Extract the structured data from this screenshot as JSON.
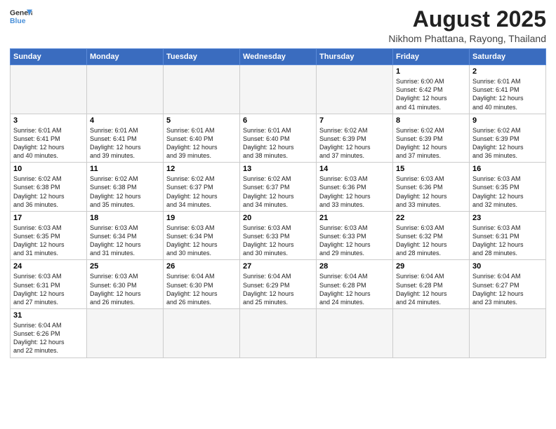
{
  "header": {
    "logo_general": "General",
    "logo_blue": "Blue",
    "title": "August 2025",
    "subtitle": "Nikhom Phattana, Rayong, Thailand"
  },
  "weekdays": [
    "Sunday",
    "Monday",
    "Tuesday",
    "Wednesday",
    "Thursday",
    "Friday",
    "Saturday"
  ],
  "weeks": [
    [
      {
        "day": "",
        "info": ""
      },
      {
        "day": "",
        "info": ""
      },
      {
        "day": "",
        "info": ""
      },
      {
        "day": "",
        "info": ""
      },
      {
        "day": "",
        "info": ""
      },
      {
        "day": "1",
        "info": "Sunrise: 6:00 AM\nSunset: 6:42 PM\nDaylight: 12 hours\nand 41 minutes."
      },
      {
        "day": "2",
        "info": "Sunrise: 6:01 AM\nSunset: 6:41 PM\nDaylight: 12 hours\nand 40 minutes."
      }
    ],
    [
      {
        "day": "3",
        "info": "Sunrise: 6:01 AM\nSunset: 6:41 PM\nDaylight: 12 hours\nand 40 minutes."
      },
      {
        "day": "4",
        "info": "Sunrise: 6:01 AM\nSunset: 6:41 PM\nDaylight: 12 hours\nand 39 minutes."
      },
      {
        "day": "5",
        "info": "Sunrise: 6:01 AM\nSunset: 6:40 PM\nDaylight: 12 hours\nand 39 minutes."
      },
      {
        "day": "6",
        "info": "Sunrise: 6:01 AM\nSunset: 6:40 PM\nDaylight: 12 hours\nand 38 minutes."
      },
      {
        "day": "7",
        "info": "Sunrise: 6:02 AM\nSunset: 6:39 PM\nDaylight: 12 hours\nand 37 minutes."
      },
      {
        "day": "8",
        "info": "Sunrise: 6:02 AM\nSunset: 6:39 PM\nDaylight: 12 hours\nand 37 minutes."
      },
      {
        "day": "9",
        "info": "Sunrise: 6:02 AM\nSunset: 6:39 PM\nDaylight: 12 hours\nand 36 minutes."
      }
    ],
    [
      {
        "day": "10",
        "info": "Sunrise: 6:02 AM\nSunset: 6:38 PM\nDaylight: 12 hours\nand 36 minutes."
      },
      {
        "day": "11",
        "info": "Sunrise: 6:02 AM\nSunset: 6:38 PM\nDaylight: 12 hours\nand 35 minutes."
      },
      {
        "day": "12",
        "info": "Sunrise: 6:02 AM\nSunset: 6:37 PM\nDaylight: 12 hours\nand 34 minutes."
      },
      {
        "day": "13",
        "info": "Sunrise: 6:02 AM\nSunset: 6:37 PM\nDaylight: 12 hours\nand 34 minutes."
      },
      {
        "day": "14",
        "info": "Sunrise: 6:03 AM\nSunset: 6:36 PM\nDaylight: 12 hours\nand 33 minutes."
      },
      {
        "day": "15",
        "info": "Sunrise: 6:03 AM\nSunset: 6:36 PM\nDaylight: 12 hours\nand 33 minutes."
      },
      {
        "day": "16",
        "info": "Sunrise: 6:03 AM\nSunset: 6:35 PM\nDaylight: 12 hours\nand 32 minutes."
      }
    ],
    [
      {
        "day": "17",
        "info": "Sunrise: 6:03 AM\nSunset: 6:35 PM\nDaylight: 12 hours\nand 31 minutes."
      },
      {
        "day": "18",
        "info": "Sunrise: 6:03 AM\nSunset: 6:34 PM\nDaylight: 12 hours\nand 31 minutes."
      },
      {
        "day": "19",
        "info": "Sunrise: 6:03 AM\nSunset: 6:34 PM\nDaylight: 12 hours\nand 30 minutes."
      },
      {
        "day": "20",
        "info": "Sunrise: 6:03 AM\nSunset: 6:33 PM\nDaylight: 12 hours\nand 30 minutes."
      },
      {
        "day": "21",
        "info": "Sunrise: 6:03 AM\nSunset: 6:33 PM\nDaylight: 12 hours\nand 29 minutes."
      },
      {
        "day": "22",
        "info": "Sunrise: 6:03 AM\nSunset: 6:32 PM\nDaylight: 12 hours\nand 28 minutes."
      },
      {
        "day": "23",
        "info": "Sunrise: 6:03 AM\nSunset: 6:31 PM\nDaylight: 12 hours\nand 28 minutes."
      }
    ],
    [
      {
        "day": "24",
        "info": "Sunrise: 6:03 AM\nSunset: 6:31 PM\nDaylight: 12 hours\nand 27 minutes."
      },
      {
        "day": "25",
        "info": "Sunrise: 6:03 AM\nSunset: 6:30 PM\nDaylight: 12 hours\nand 26 minutes."
      },
      {
        "day": "26",
        "info": "Sunrise: 6:04 AM\nSunset: 6:30 PM\nDaylight: 12 hours\nand 26 minutes."
      },
      {
        "day": "27",
        "info": "Sunrise: 6:04 AM\nSunset: 6:29 PM\nDaylight: 12 hours\nand 25 minutes."
      },
      {
        "day": "28",
        "info": "Sunrise: 6:04 AM\nSunset: 6:28 PM\nDaylight: 12 hours\nand 24 minutes."
      },
      {
        "day": "29",
        "info": "Sunrise: 6:04 AM\nSunset: 6:28 PM\nDaylight: 12 hours\nand 24 minutes."
      },
      {
        "day": "30",
        "info": "Sunrise: 6:04 AM\nSunset: 6:27 PM\nDaylight: 12 hours\nand 23 minutes."
      }
    ],
    [
      {
        "day": "31",
        "info": "Sunrise: 6:04 AM\nSunset: 6:26 PM\nDaylight: 12 hours\nand 22 minutes."
      },
      {
        "day": "",
        "info": ""
      },
      {
        "day": "",
        "info": ""
      },
      {
        "day": "",
        "info": ""
      },
      {
        "day": "",
        "info": ""
      },
      {
        "day": "",
        "info": ""
      },
      {
        "day": "",
        "info": ""
      }
    ]
  ]
}
